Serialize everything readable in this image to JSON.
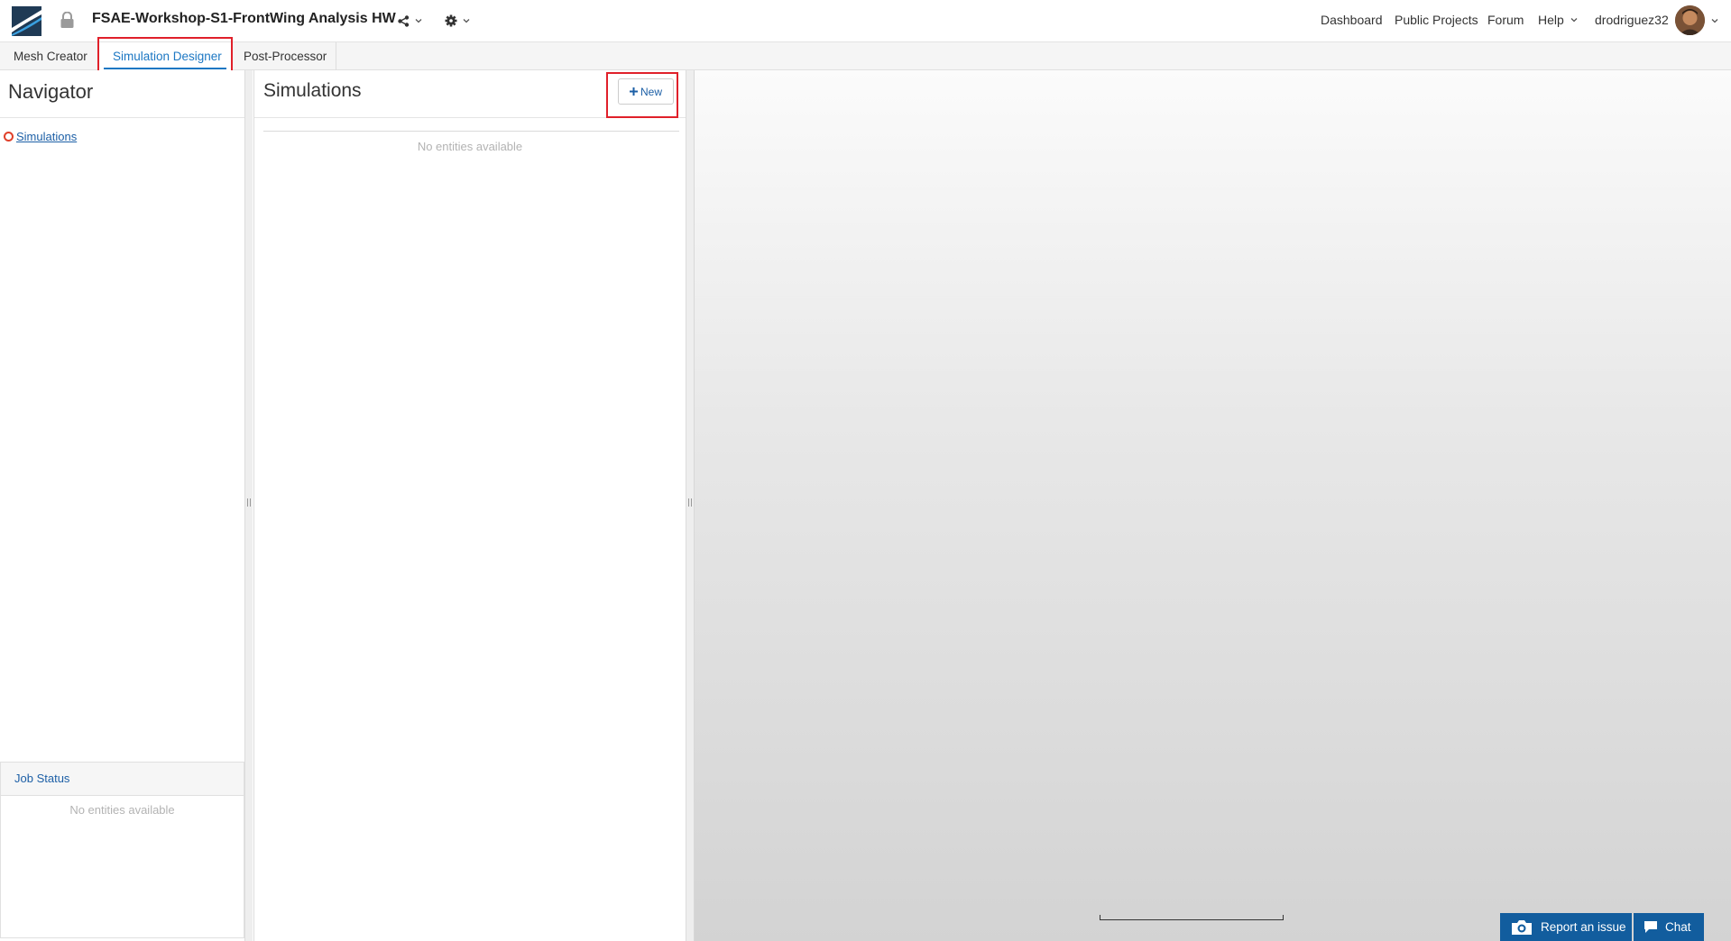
{
  "header": {
    "project_title": "FSAE-Workshop-S1-FrontWing Analysis HW",
    "icons": {
      "logo": "simscale-logo-icon",
      "lock": "lock-icon",
      "share": "share-icon",
      "settings": "gear-icon",
      "dropdown": "chevron-down-icon"
    },
    "nav": {
      "dashboard": "Dashboard",
      "public_projects": "Public Projects",
      "forum": "Forum",
      "help": "Help",
      "username": "drodriguez32"
    }
  },
  "tabs": [
    {
      "label": "Mesh Creator",
      "active": false
    },
    {
      "label": "Simulation Designer",
      "active": true
    },
    {
      "label": "Post-Processor",
      "active": false
    }
  ],
  "navigator": {
    "title": "Navigator",
    "tree_item": "Simulations",
    "job_status": {
      "title": "Job Status",
      "empty_text": "No entities available"
    }
  },
  "simulations": {
    "title": "Simulations",
    "new_button": "New",
    "empty_text": "No entities available"
  },
  "footer": {
    "report_button": "Report an issue",
    "chat_button": "Chat"
  },
  "colors": {
    "accent": "#1c77c3",
    "link": "#1c5fa6",
    "highlight": "#e0202a",
    "footer_button": "#125d9e"
  }
}
